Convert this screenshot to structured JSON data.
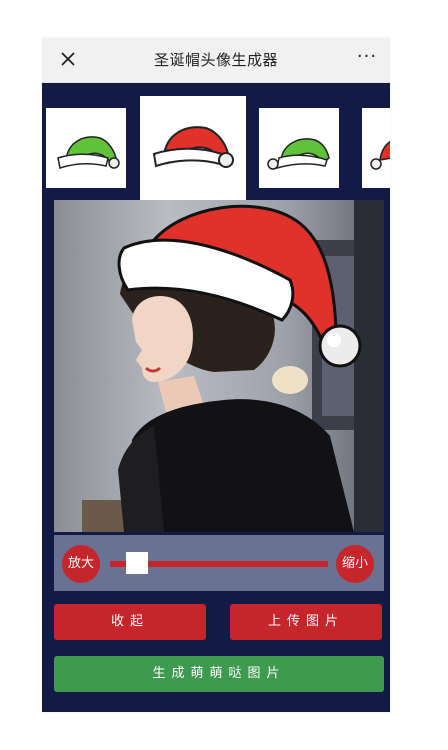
{
  "window": {
    "title": "圣诞帽头像生成器",
    "more_label": "···"
  },
  "hat_options": [
    {
      "color": "green",
      "icon": "green-santa-hat-icon",
      "selected": false
    },
    {
      "color": "red",
      "icon": "red-santa-hat-icon",
      "selected": true
    },
    {
      "color": "green",
      "icon": "green-santa-hat-icon",
      "selected": false
    },
    {
      "color": "red",
      "icon": "red-santa-hat-icon",
      "selected": false
    }
  ],
  "scale_controls": {
    "zoom_in_label": "放大",
    "zoom_out_label": "缩小",
    "slider_level": 0.08
  },
  "actions": {
    "collapse_label": "收起",
    "upload_label": "上传图片",
    "generate_label": "生成萌萌哒图片"
  },
  "colors": {
    "background": "#121a45",
    "accent_red": "#c4262b",
    "accent_green": "#3e9a4f",
    "hat_red": "#e0312b",
    "hat_green": "#5fc23a"
  }
}
